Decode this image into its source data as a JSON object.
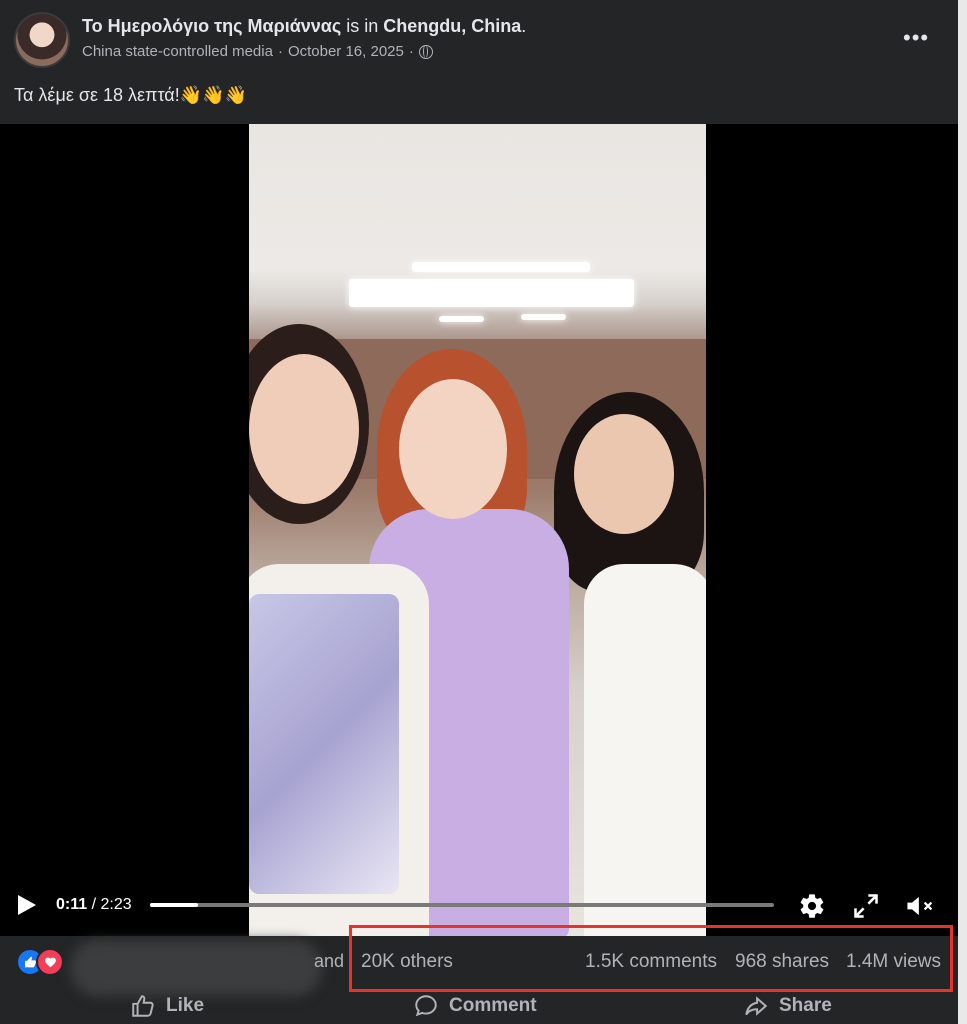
{
  "post": {
    "author": "Το Ημερολόγιο της Μαριάννας",
    "is_in_text": "is in",
    "location": "Chengdu, China",
    "location_suffix": ".",
    "label": "China state-controlled media",
    "separator": "·",
    "date": "October 16, 2025",
    "privacy_icon": "globe-icon",
    "more_label": "•••",
    "caption": "Τα λέμε σε 18 λεπτά!👋👋👋"
  },
  "video": {
    "current_time": "0:11",
    "duration": "/ 2:23",
    "progress_fraction": 0.077
  },
  "stats": {
    "and_text": "and",
    "others": "20K others",
    "comments": "1.5K comments",
    "shares": "968 shares",
    "views": "1.4M views",
    "highlight_color": "#e8322c"
  },
  "actions": {
    "like": "Like",
    "comment": "Comment",
    "share": "Share"
  }
}
